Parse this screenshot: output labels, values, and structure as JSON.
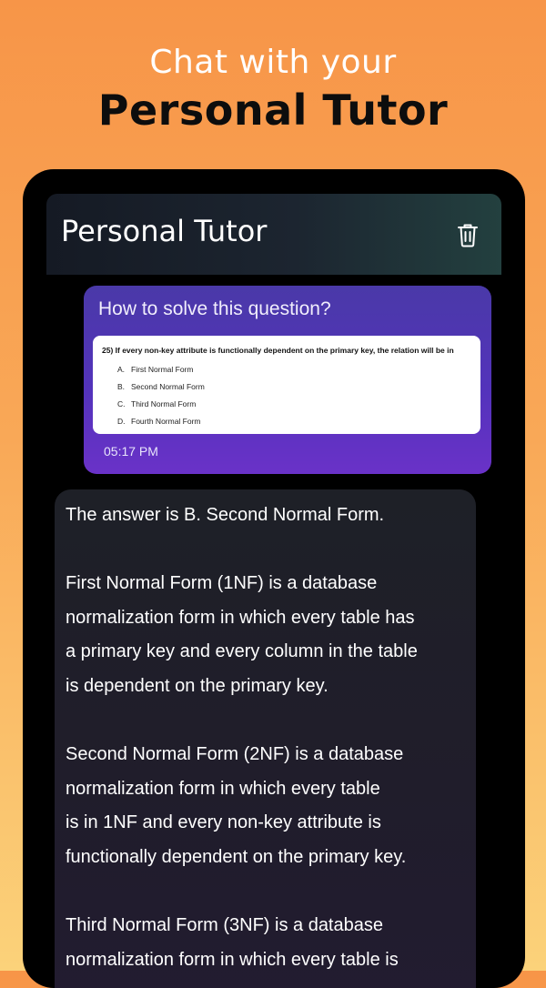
{
  "promo": {
    "line1": "Chat with your",
    "line2": "Personal Tutor"
  },
  "header": {
    "title": "Personal Tutor",
    "delete_icon": "trash-icon"
  },
  "user_message": {
    "text": "How to solve this question?",
    "time": "05:17 PM",
    "attachment": {
      "question": "25) If every non-key attribute is functionally dependent on the primary key, the relation will be in",
      "options": [
        {
          "letter": "A.",
          "text": "First Normal Form"
        },
        {
          "letter": "B.",
          "text": "Second Normal Form"
        },
        {
          "letter": "C.",
          "text": "Third Normal Form"
        },
        {
          "letter": "D.",
          "text": "Fourth Normal Form"
        }
      ]
    }
  },
  "bot_message": {
    "text": "The answer is B. Second Normal Form.\n\nFirst Normal Form (1NF) is a database\nnormalization form in which every table has\na primary key and every column in the table\nis dependent on the primary key.\n\nSecond Normal Form (2NF) is a database\nnormalization form in which every table\nis in 1NF and every non-key attribute is\nfunctionally dependent on the primary key.\n\nThird Normal Form (3NF) is a database\nnormalization form in which every table is"
  },
  "colors": {
    "bg_top": "#F79548",
    "bg_bottom": "#FBD27A",
    "user_bubble": "#5333BB",
    "bot_bubble": "#201D2B",
    "phone_frame": "#000000"
  }
}
